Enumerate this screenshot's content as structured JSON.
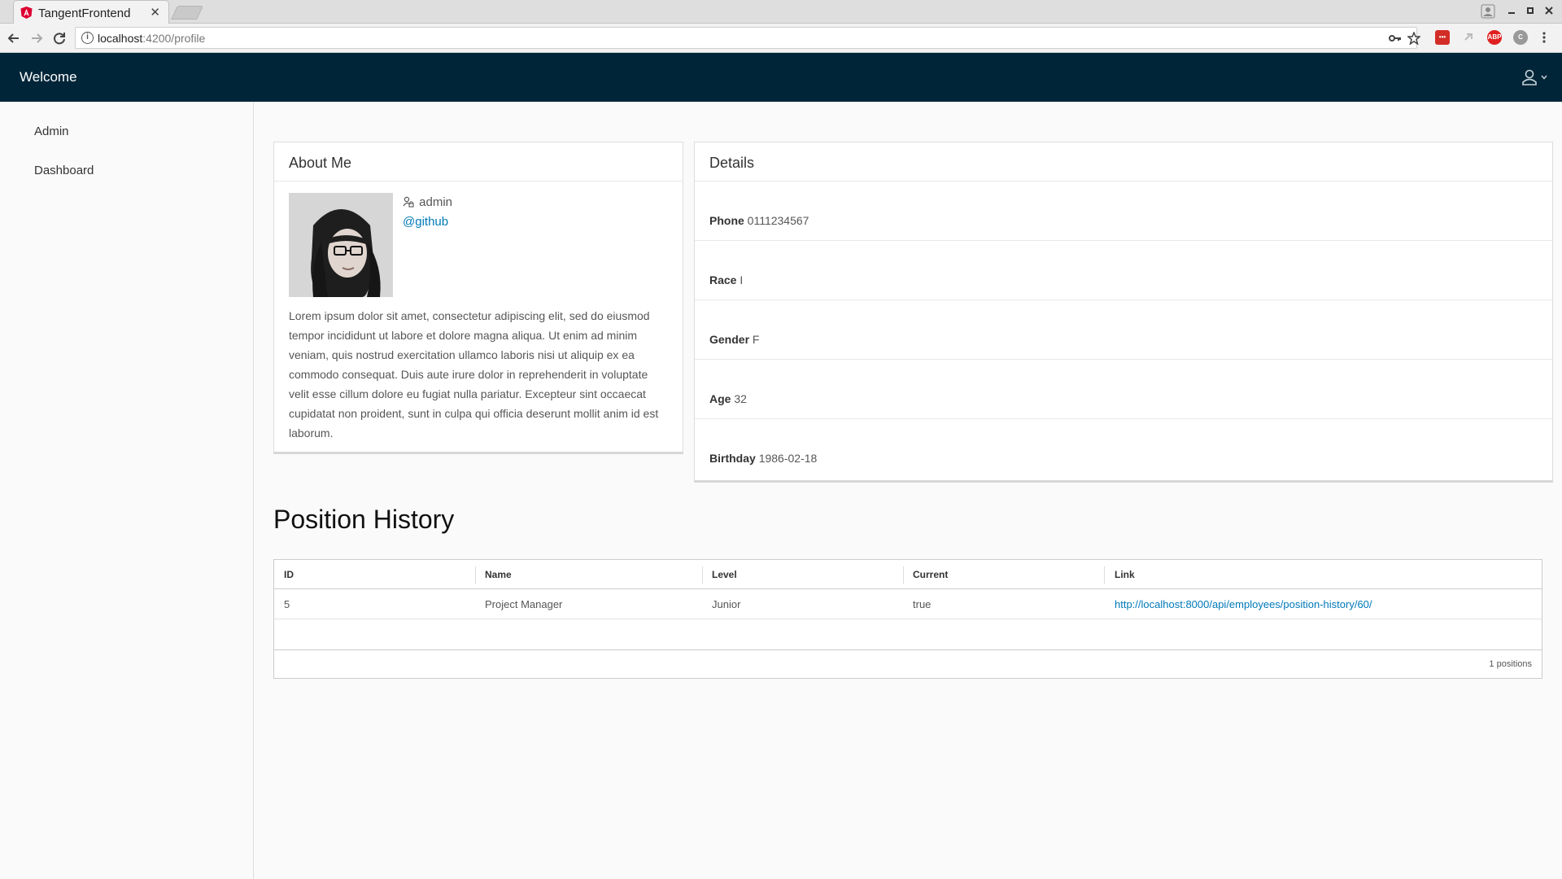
{
  "browser": {
    "tab_title": "TangentFrontend",
    "tab_close": "✕",
    "url_host": "localhost",
    "url_rest": ":4200/profile"
  },
  "header": {
    "brand": "Welcome"
  },
  "sidebar": {
    "items": [
      {
        "label": "Admin"
      },
      {
        "label": "Dashboard"
      }
    ]
  },
  "about": {
    "title": "About Me",
    "username": "admin",
    "github": "@github",
    "bio": "Lorem ipsum dolor sit amet, consectetur adipiscing elit, sed do eiusmod tempor incididunt ut labore et dolore magna aliqua. Ut enim ad minim veniam, quis nostrud exercitation ullamco laboris nisi ut aliquip ex ea commodo consequat. Duis aute irure dolor in reprehenderit in voluptate velit esse cillum dolore eu fugiat nulla pariatur. Excepteur sint occaecat cupidatat non proident, sunt in culpa qui officia deserunt mollit anim id est laborum."
  },
  "details": {
    "title": "Details",
    "rows": [
      {
        "label": "Phone",
        "value": "0111234567"
      },
      {
        "label": "Race",
        "value": "I"
      },
      {
        "label": "Gender",
        "value": "F"
      },
      {
        "label": "Age",
        "value": "32"
      },
      {
        "label": "Birthday",
        "value": "1986-02-18"
      }
    ]
  },
  "positions": {
    "title": "Position History",
    "columns": [
      "ID",
      "Name",
      "Level",
      "Current",
      "Link"
    ],
    "rows": [
      {
        "id": "5",
        "name": "Project Manager",
        "level": "Junior",
        "current": "true",
        "link": "http://localhost:8000/api/employees/position-history/60/"
      }
    ],
    "footer": "1 positions"
  },
  "colors": {
    "header_bg": "#002538",
    "link": "#0079b8"
  }
}
